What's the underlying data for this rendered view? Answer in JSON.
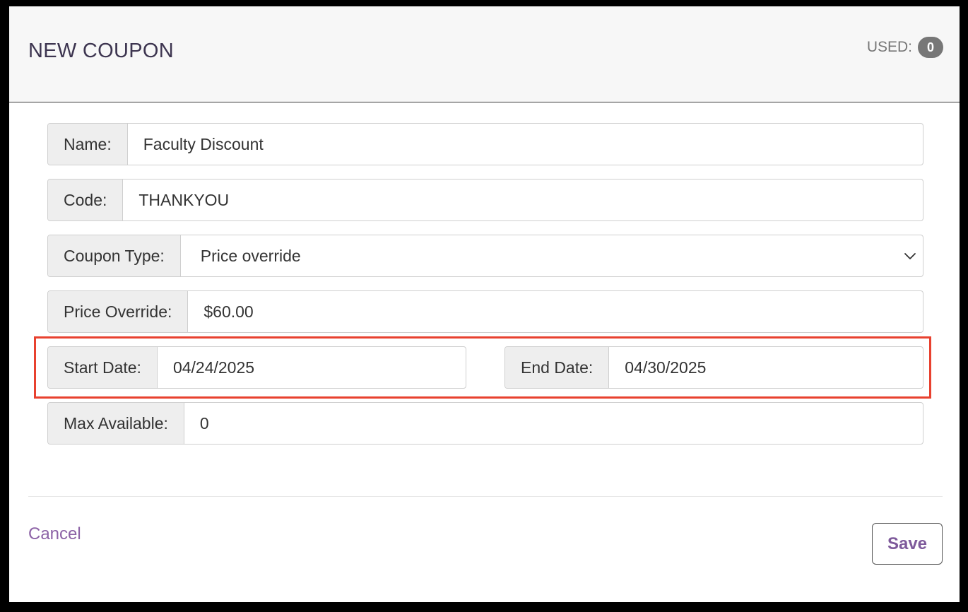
{
  "header": {
    "title": "NEW COUPON",
    "used_label": "USED:",
    "used_count": "0"
  },
  "form": {
    "name": {
      "label": "Name:",
      "value": "Faculty Discount"
    },
    "code": {
      "label": "Code:",
      "value": "THANKYOU"
    },
    "coupon_type": {
      "label": "Coupon Type:",
      "value": "Price override"
    },
    "price_override": {
      "label": "Price Override:",
      "value": "$60.00"
    },
    "start_date": {
      "label": "Start Date:",
      "value": "04/24/2025"
    },
    "end_date": {
      "label": "End Date:",
      "value": "04/30/2025"
    },
    "max_available": {
      "label": "Max Available:",
      "value": "0"
    }
  },
  "footer": {
    "cancel_label": "Cancel",
    "save_label": "Save"
  },
  "colors": {
    "accent": "#8c62a6",
    "highlight": "#e8412f",
    "badge": "#777777"
  },
  "icons": {
    "select_arrow": "chevron-down-icon"
  }
}
